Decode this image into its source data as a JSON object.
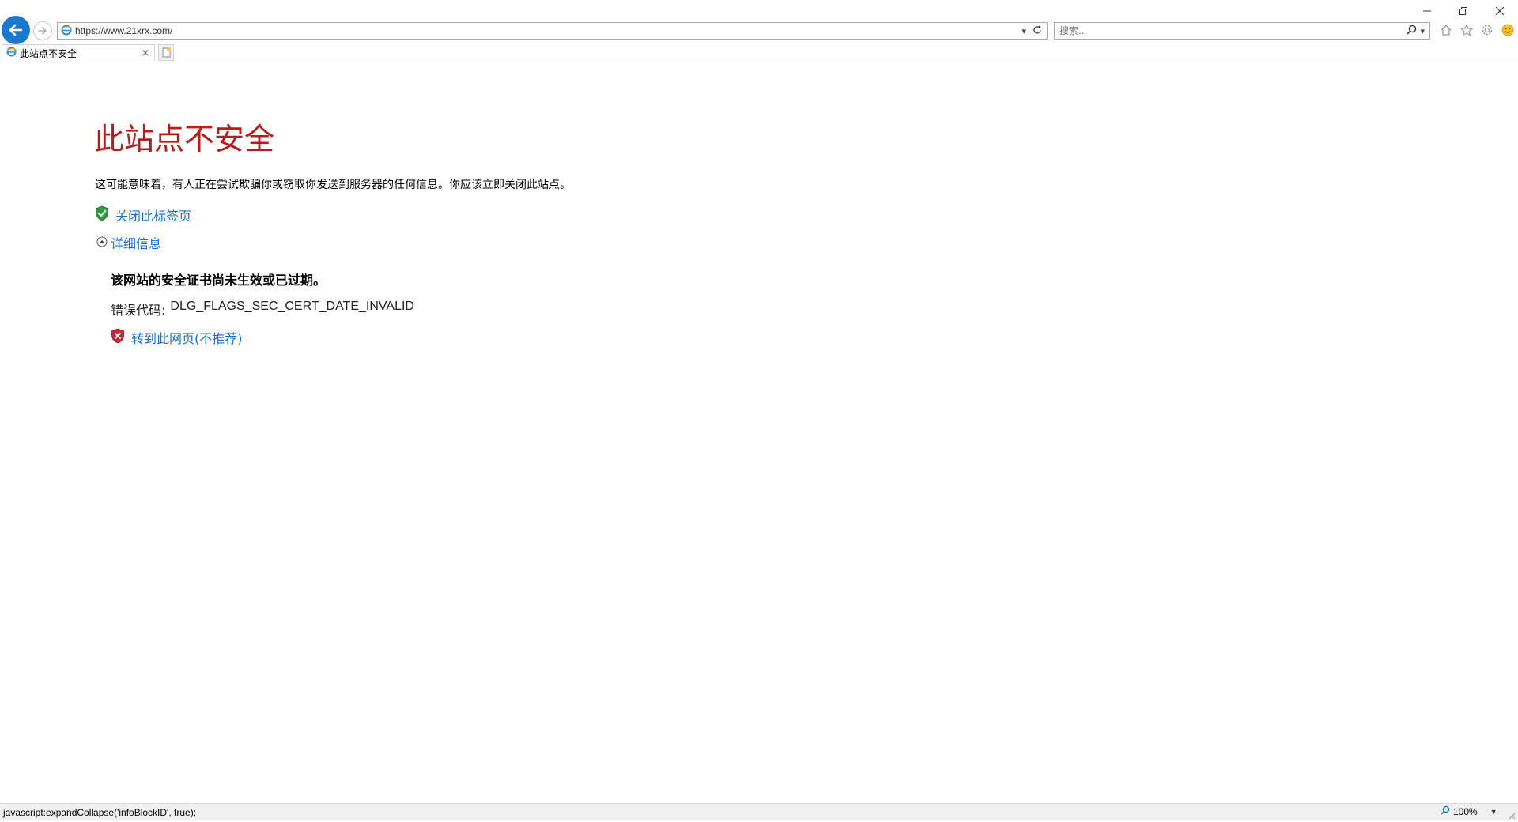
{
  "browser": {
    "address": "https://www.21xrx.com/",
    "search_placeholder": "搜索...",
    "tab_title": "此站点不安全",
    "tab_close": "×"
  },
  "page": {
    "title": "此站点不安全",
    "description": "这可能意味着，有人正在尝试欺骗你或窃取你发送到服务器的任何信息。你应该立即关闭此站点。",
    "close_tab_link": "关闭此标签页",
    "details_link": "详细信息",
    "cert_message": "该网站的安全证书尚未生效或已过期。",
    "error_code_label": "错误代码:",
    "error_code_value": "DLG_FLAGS_SEC_CERT_DATE_INVALID",
    "goto_link": "转到此网页(不推荐)"
  },
  "status_bar": {
    "text": "javascript:expandCollapse('infoBlockID', true);",
    "zoom": "100%"
  },
  "colors": {
    "title_red": "#b51c1c",
    "link_blue": "#1a6fd1",
    "back_button": "#1979ca"
  }
}
